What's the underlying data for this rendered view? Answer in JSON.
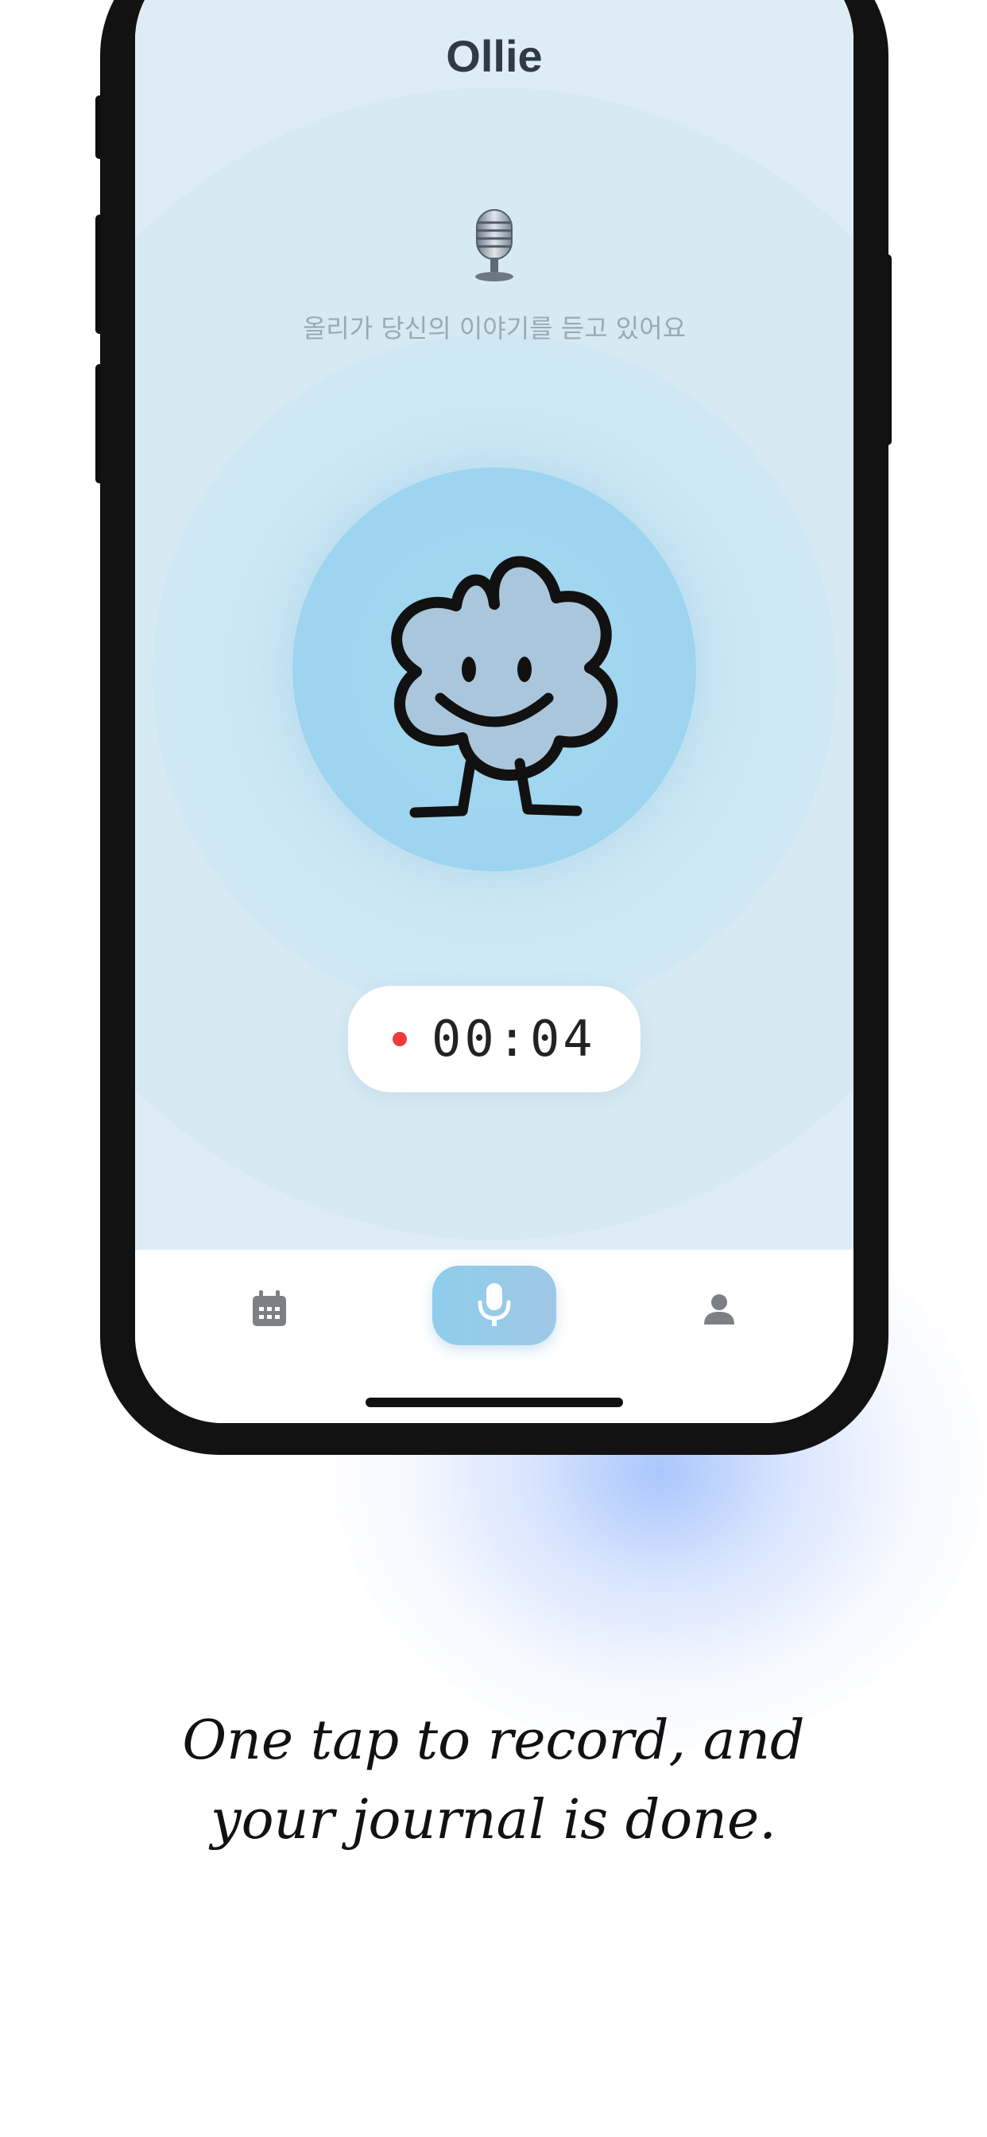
{
  "app": {
    "title": "Ollie"
  },
  "recording": {
    "status_text": "올리가 당신의 이야기를 듣고 있어요",
    "timer": "00:04",
    "status_icon": "studio-microphone-icon",
    "recording_indicator_color": "#ee3a3a"
  },
  "tab_bar": {
    "items": [
      {
        "icon": "calendar-icon",
        "active": false
      },
      {
        "icon": "microphone-icon",
        "active": true
      },
      {
        "icon": "person-icon",
        "active": false
      }
    ]
  },
  "caption": {
    "line1": "One tap to record, and",
    "line2": "your journal is done."
  },
  "colors": {
    "accent": "#9dd4ef",
    "background": "#deedf5"
  }
}
